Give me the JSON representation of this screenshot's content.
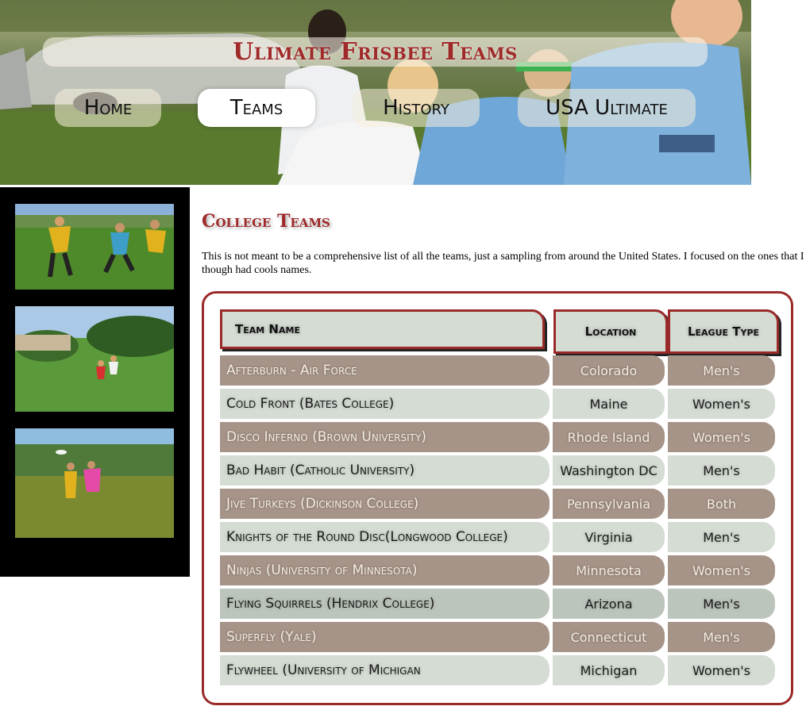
{
  "site": {
    "title": "Ulimate Frisbee Teams"
  },
  "nav": {
    "items": [
      {
        "label": "Home",
        "active": false
      },
      {
        "label": "Teams",
        "active": true
      },
      {
        "label": "History",
        "active": false
      },
      {
        "label": "USA Ultimate",
        "active": false
      }
    ]
  },
  "sidebar": {
    "photos": [
      "ultimate-game-photo",
      "field-play-photo",
      "frisbee-catch-photo"
    ]
  },
  "main": {
    "heading": "College Teams",
    "intro": "This is not meant to be a comprehensive list of all the teams, just a sampling from around the United States. I focused on the ones that I though had cools names.",
    "table": {
      "headers": {
        "name": "Team Name",
        "location": "Location",
        "type": "League Type"
      },
      "rows": [
        {
          "name": "Afterburn - Air Force",
          "location": "Colorado",
          "type": "Men's"
        },
        {
          "name": "Cold Front (Bates College)",
          "location": "Maine",
          "type": "Women's"
        },
        {
          "name": "Disco Inferno (Brown University)",
          "location": "Rhode Island",
          "type": "Women's"
        },
        {
          "name": "Bad Habit (Catholic University)",
          "location": "Washington DC",
          "type": "Men's"
        },
        {
          "name": "Jive Turkeys (Dickinson College)",
          "location": "Pennsylvania",
          "type": "Both"
        },
        {
          "name": "Knights of the Round Disc(Longwood College)",
          "location": "Virginia",
          "type": "Men's"
        },
        {
          "name": "Ninjas (University of Minnesota)",
          "location": "Minnesota",
          "type": "Women's"
        },
        {
          "name": "Flying Squirrels (Hendrix College)",
          "location": "Arizona",
          "type": "Men's"
        },
        {
          "name": "Superfly (Yale)",
          "location": "Connecticut",
          "type": "Men's"
        },
        {
          "name": "Flywheel (University of Michigan",
          "location": "Michigan",
          "type": "Women's"
        }
      ]
    }
  },
  "colors": {
    "accent": "#a02a2a",
    "row_odd": "#a79488",
    "row_even": "#d4dcd3"
  }
}
